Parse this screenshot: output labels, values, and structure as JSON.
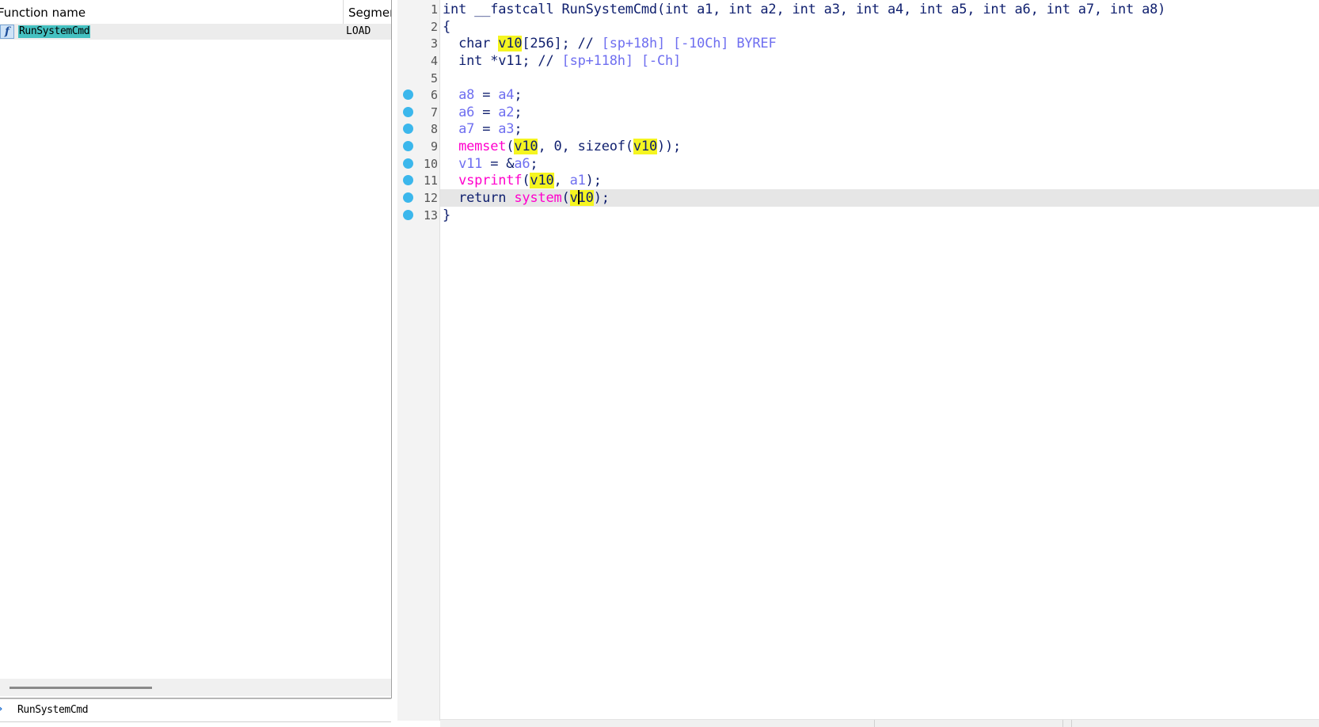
{
  "function_list": {
    "columns": {
      "function_name": "Function name",
      "segment": "Segmer"
    },
    "rows": [
      {
        "icon": "function-icon",
        "icon_glyph": "f",
        "name": "RunSystemCmd",
        "segment": "LOAD"
      }
    ],
    "bottom_label": "RunSystemCmd"
  },
  "pseudocode": {
    "breakpoint_color": "#3bb7ec",
    "highlight_color": "#f5f520",
    "current_line": 12,
    "lines": [
      {
        "n": "1",
        "bp": false
      },
      {
        "n": "2",
        "bp": false
      },
      {
        "n": "3",
        "bp": false
      },
      {
        "n": "4",
        "bp": false
      },
      {
        "n": "5",
        "bp": false
      },
      {
        "n": "6",
        "bp": true
      },
      {
        "n": "7",
        "bp": true
      },
      {
        "n": "8",
        "bp": true
      },
      {
        "n": "9",
        "bp": true
      },
      {
        "n": "10",
        "bp": true
      },
      {
        "n": "11",
        "bp": true
      },
      {
        "n": "12",
        "bp": true
      },
      {
        "n": "13",
        "bp": true
      }
    ],
    "tokens": {
      "l1": {
        "sig": "int __fastcall RunSystemCmd(int a1, int a2, int a3, int a4, int a5, int a6, int a7, int a8)"
      },
      "l2": {
        "brace": "{"
      },
      "l3": {
        "type": "char ",
        "var": "v10",
        "rest": "[256]; // ",
        "comment": "[sp+18h] [-10Ch] BYREF"
      },
      "l4": {
        "type": "int *v11; // ",
        "comment": "[sp+118h] [-Ch]"
      },
      "l6": {
        "lhs": "a8",
        "op": " = ",
        "rhs": "a4",
        "end": ";"
      },
      "l7": {
        "lhs": "a6",
        "op": " = ",
        "rhs": "a2",
        "end": ";"
      },
      "l8": {
        "lhs": "a7",
        "op": " = ",
        "rhs": "a3",
        "end": ";"
      },
      "l9": {
        "fn": "memset",
        "p1": "(",
        "v": "v10",
        "mid": ", 0, sizeof(",
        "v2": "v10",
        "end": "));"
      },
      "l10": {
        "lhs": "v11",
        "op": " = &",
        "rhs": "a6",
        "end": ";"
      },
      "l11": {
        "fn": "vsprintf",
        "p1": "(",
        "v": "v10",
        "mid": ", ",
        "arg": "a1",
        "end": ");"
      },
      "l12": {
        "kw": "return ",
        "fn": "system",
        "p1": "(",
        "v_a": "v",
        "v_b": "10",
        "end": ");"
      },
      "l13": {
        "brace": "}"
      }
    }
  }
}
